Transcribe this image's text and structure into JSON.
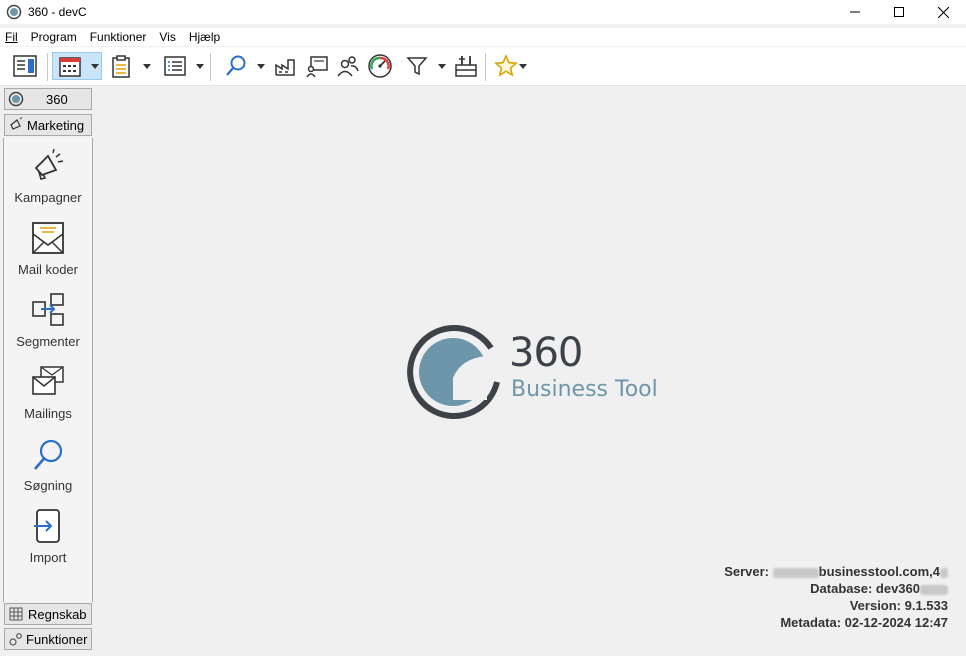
{
  "window": {
    "title": "360 - devC"
  },
  "menu": {
    "items": [
      "Fil",
      "Program",
      "Funktioner",
      "Vis",
      "Hjælp"
    ]
  },
  "sidebar": {
    "top_section": "360",
    "active_section": "Marketing",
    "items": [
      {
        "label": "Kampagner",
        "icon": "megaphone-icon"
      },
      {
        "label": "Mail koder",
        "icon": "envelope-codes-icon"
      },
      {
        "label": "Segmenter",
        "icon": "segment-arrows-icon"
      },
      {
        "label": "Mailings",
        "icon": "mailings-icon"
      },
      {
        "label": "Søgning",
        "icon": "search-icon"
      },
      {
        "label": "Import",
        "icon": "import-icon"
      }
    ],
    "bottom_sections": [
      {
        "label": "Regnskab",
        "icon": "table-grid-icon"
      },
      {
        "label": "Funktioner",
        "icon": "gears-icon"
      }
    ]
  },
  "logo": {
    "number": "360",
    "subtitle": "Business Tool"
  },
  "info": {
    "server_label": "Server:",
    "server_value": "businesstool.com,4",
    "database_label": "Database:",
    "database_value": "dev360",
    "version": "Version: 9.1.533",
    "metadata": "Metadata: 02-12-2024 12:47"
  },
  "colors": {
    "accent": "#2a6fc9",
    "logo_dark": "#3c4247",
    "logo_blue": "#6d96ab",
    "star": "#d9a400"
  }
}
